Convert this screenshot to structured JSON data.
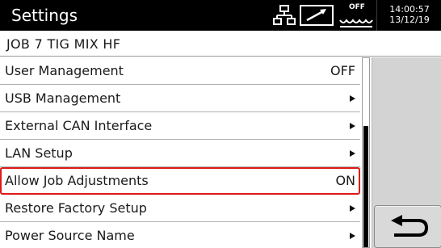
{
  "header": {
    "title": "Settings",
    "icons": [
      "network-icon",
      "signal-icon",
      "wave-icon"
    ],
    "wave_status": "OFF",
    "time": "14:00:57",
    "date": "13/12/19",
    "background": "#000000"
  },
  "job": {
    "text": "JOB 7  TIG  MIX  HF"
  },
  "menu": {
    "items": [
      {
        "label": "User Management",
        "value": "OFF",
        "has_arrow": false,
        "selected": false
      },
      {
        "label": "USB Management",
        "value": "",
        "has_arrow": true,
        "selected": false
      },
      {
        "label": "External CAN Interface",
        "value": "",
        "has_arrow": true,
        "selected": false
      },
      {
        "label": "LAN Setup",
        "value": "",
        "has_arrow": true,
        "selected": false
      },
      {
        "label": "Allow Job Adjustments",
        "value": "ON",
        "has_arrow": false,
        "selected": true
      },
      {
        "label": "Restore Factory Setup",
        "value": "",
        "has_arrow": true,
        "selected": false
      },
      {
        "label": "Power Source Name",
        "value": "",
        "has_arrow": true,
        "selected": false
      }
    ],
    "selection_color": "#e01818"
  },
  "scrollbar": {
    "thumb_start_fraction": 0.36,
    "thumb_end_fraction": 1.0
  },
  "side_panel": {
    "back_icon": "return-arrow-icon"
  }
}
